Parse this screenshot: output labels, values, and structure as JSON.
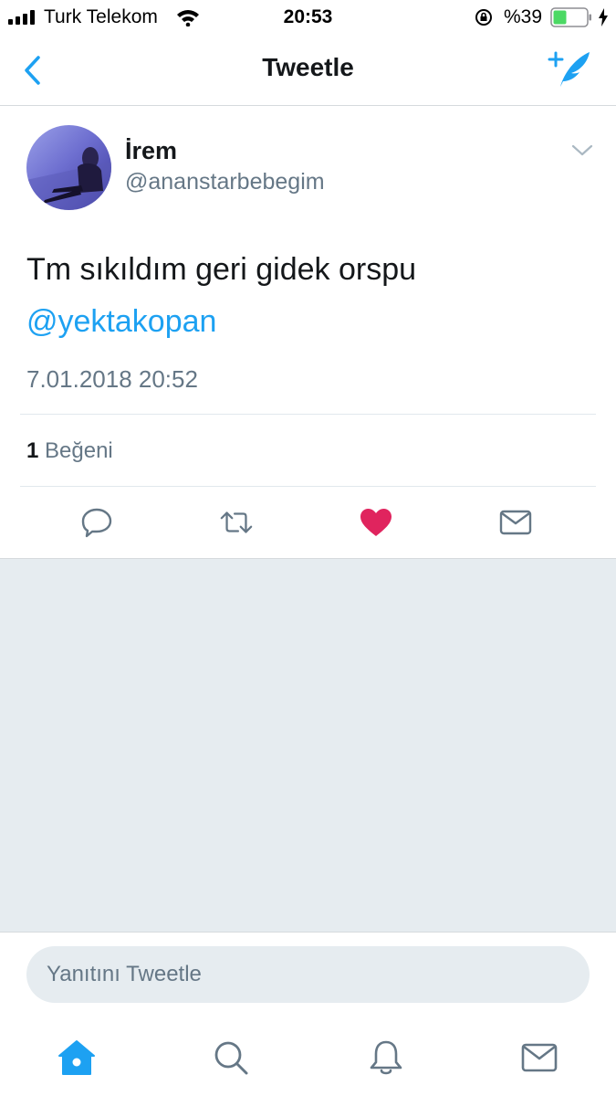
{
  "status_bar": {
    "carrier": "Turk Telekom",
    "time": "20:53",
    "battery": "%39",
    "icons": [
      "signal-icon",
      "wifi-icon",
      "rotation-lock-icon",
      "battery-icon",
      "charging-icon"
    ]
  },
  "nav": {
    "title": "Tweetle",
    "back_icon": "chevron-left-icon",
    "compose_icon": "compose-tweet-icon"
  },
  "tweet": {
    "display_name": "İrem",
    "handle": "@ananstarbebegim",
    "text": "Tm sıkıldım geri gidek orspu",
    "mention": "@yektakopan",
    "timestamp": "7.01.2018 20:52",
    "likes_count": "1",
    "likes_label": "Beğeni",
    "liked": true
  },
  "actions": [
    "reply-icon",
    "retweet-icon",
    "like-icon",
    "direct-message-icon"
  ],
  "reply": {
    "placeholder": "Yanıtını Tweetle"
  },
  "tab_bar": [
    "home-icon",
    "search-icon",
    "notifications-icon",
    "messages-icon"
  ],
  "colors": {
    "accent": "#1da1f2",
    "like": "#e0245e",
    "secondary_text": "#657786",
    "background_gray": "#e6ecf0"
  }
}
